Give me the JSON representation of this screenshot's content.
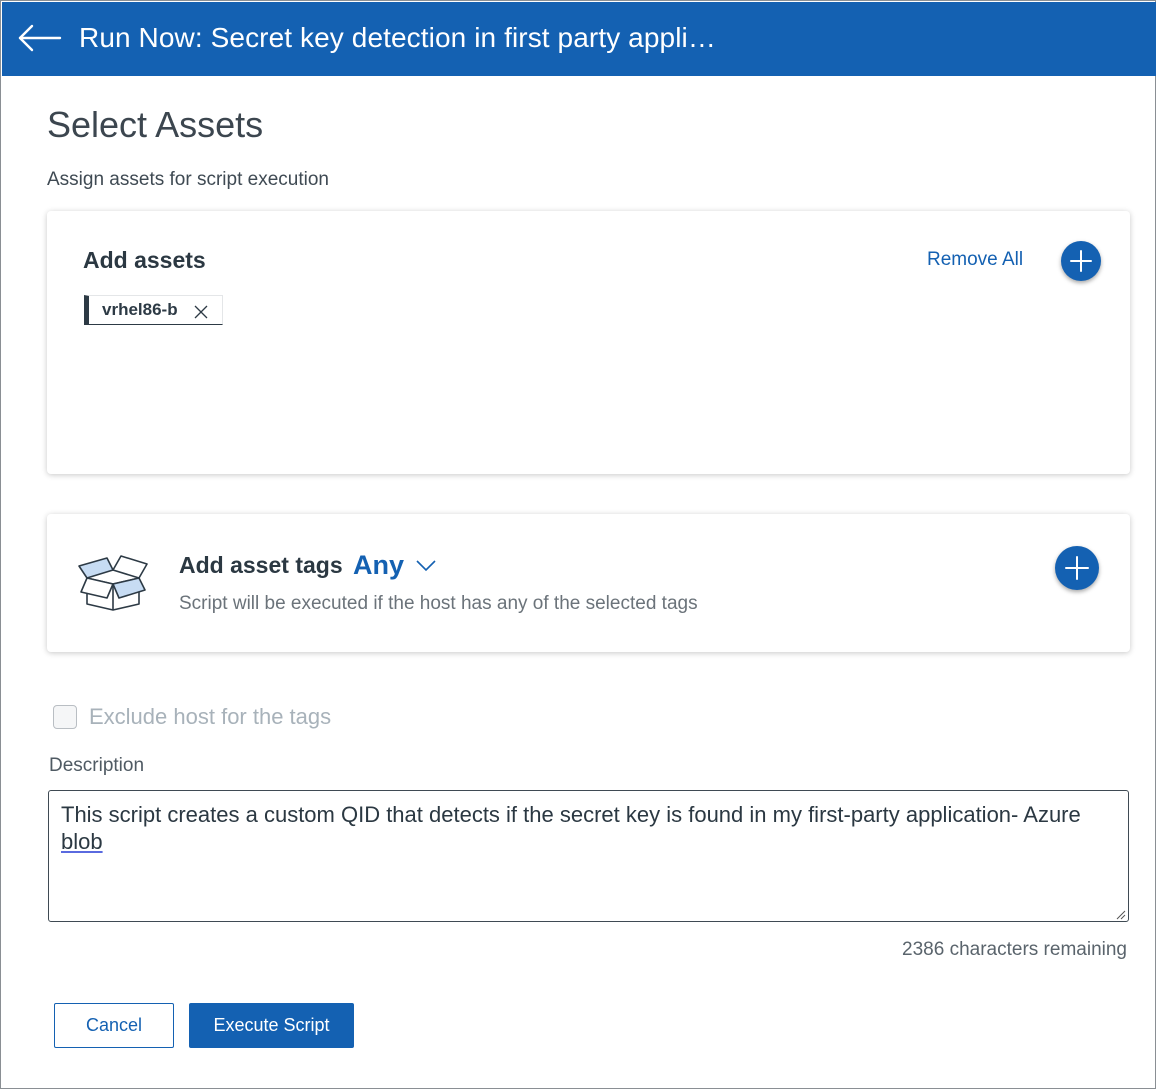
{
  "header": {
    "title": "Run Now: Secret key detection in first party appli…"
  },
  "page": {
    "title": "Select Assets",
    "subtitle": "Assign assets for script execution"
  },
  "assets_card": {
    "title": "Add assets",
    "remove_all_label": "Remove All",
    "chips": [
      {
        "label": "vrhel86-b"
      }
    ]
  },
  "tags_card": {
    "title": "Add asset tags",
    "match_mode": "Any",
    "subtitle": "Script will be executed if the host has any of the selected tags"
  },
  "exclude": {
    "label": "Exclude host for the tags",
    "checked": false
  },
  "description": {
    "label": "Description",
    "value_main": "This script creates a custom QID that detects if the secret key is found in my first-party application- Azure ",
    "value_tail": "blob",
    "chars_remaining": "2386 characters remaining"
  },
  "actions": {
    "cancel_label": "Cancel",
    "execute_label": "Execute Script"
  },
  "colors": {
    "primary": "#1461b2",
    "text": "#2d3a45"
  }
}
